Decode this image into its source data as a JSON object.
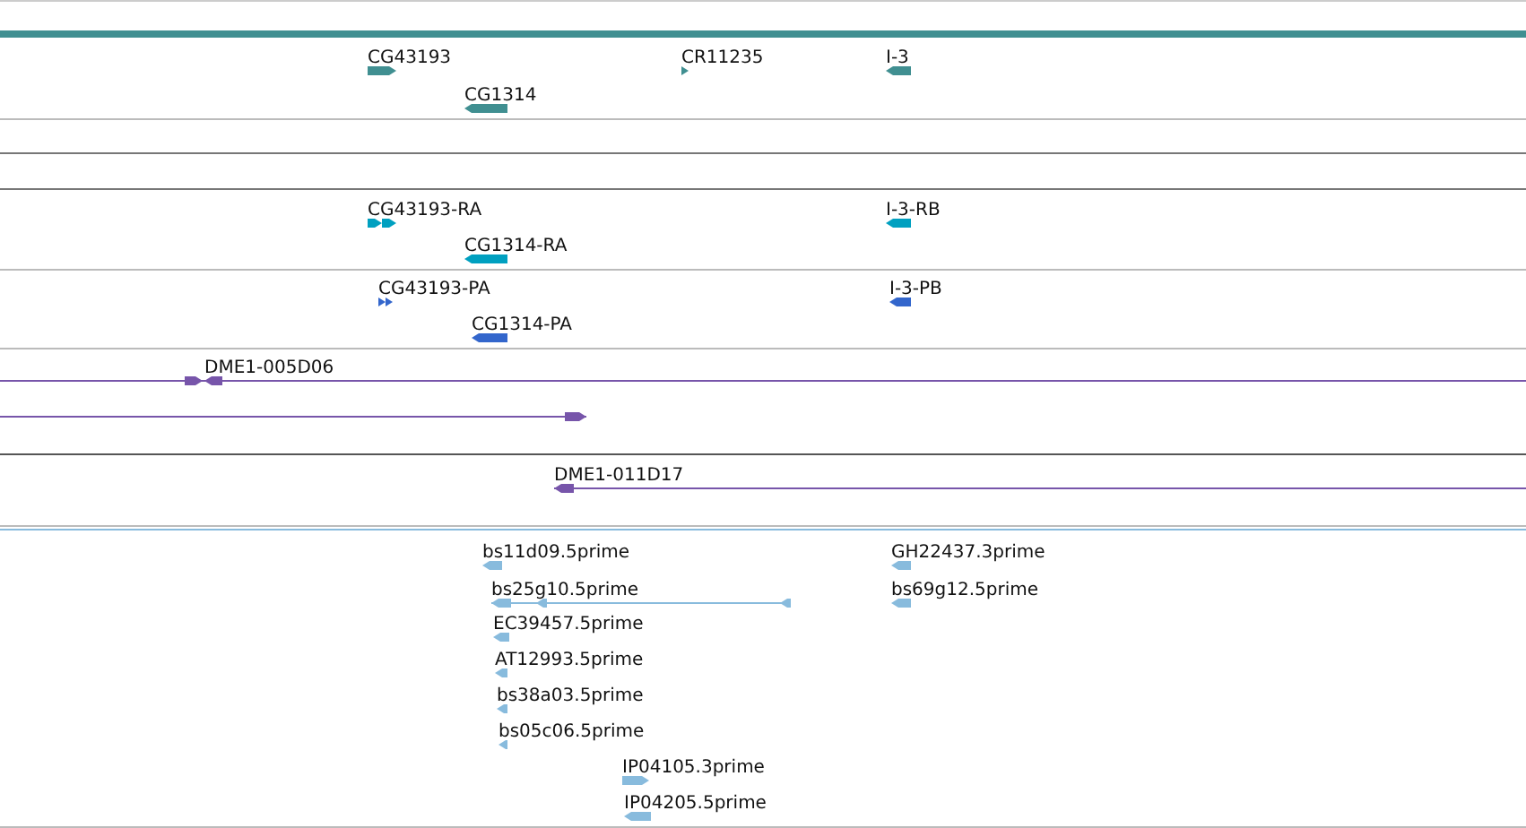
{
  "tracks": [
    {
      "color": "#408f91",
      "features": [
        {
          "label": "CG43193",
          "kind": "block",
          "reverse": false
        },
        {
          "label": "CR11235",
          "kind": "block",
          "reverse": false
        },
        {
          "label": "I-3",
          "kind": "block",
          "reverse": true
        },
        {
          "label": "CG1314",
          "kind": "block",
          "reverse": true
        }
      ]
    },
    {
      "color": "#00a0c0",
      "features": [
        {
          "label": "CG43193-RA",
          "kind": "segmented",
          "reverse": false
        },
        {
          "label": "I-3-RB",
          "kind": "block",
          "reverse": true
        },
        {
          "label": "CG1314-RA",
          "kind": "block",
          "reverse": true
        }
      ]
    },
    {
      "color": "#3366cc",
      "features": [
        {
          "label": "CG43193-PA",
          "kind": "segmented",
          "reverse": false
        },
        {
          "label": "I-3-PB",
          "kind": "block",
          "reverse": true
        },
        {
          "label": "CG1314-PA",
          "kind": "block",
          "reverse": true
        }
      ]
    },
    {
      "color": "#7755aa",
      "features": [
        {
          "label": "DME1-005D06",
          "kind": "pair",
          "reverse": false
        },
        {
          "kind": "span",
          "reverse": false
        },
        {
          "label": "DME1-011D17",
          "kind": "span",
          "reverse": true
        }
      ]
    },
    {
      "color": "#88bbdd",
      "features": [
        {
          "label": "bs11d09.5prime",
          "kind": "block",
          "reverse": true
        },
        {
          "label": "GH22437.3prime",
          "kind": "block",
          "reverse": true
        },
        {
          "label": "bs25g10.5prime",
          "kind": "spliced",
          "reverse": true
        },
        {
          "label": "bs69g12.5prime",
          "kind": "block",
          "reverse": true
        },
        {
          "label": "EC39457.5prime",
          "kind": "block",
          "reverse": true
        },
        {
          "label": "AT12993.5prime",
          "kind": "block",
          "reverse": true
        },
        {
          "label": "bs38a03.5prime",
          "kind": "block",
          "reverse": true
        },
        {
          "label": "bs05c06.5prime",
          "kind": "block",
          "reverse": true
        },
        {
          "label": "IP04105.3prime",
          "kind": "block",
          "reverse": false
        },
        {
          "label": "IP04205.5prime",
          "kind": "block",
          "reverse": true
        }
      ]
    }
  ]
}
